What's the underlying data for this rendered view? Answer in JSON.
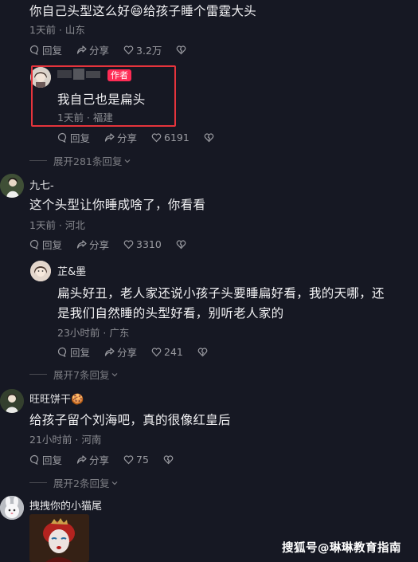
{
  "comments": [
    {
      "text": "你自己头型这么好😄给孩子睡个雷霆大头",
      "meta": "1天前 · 山东",
      "reply": "回复",
      "share": "分享",
      "likes": "3.2万"
    },
    {
      "badge": "作者",
      "text": "我自己也是扁头",
      "meta": "1天前 · 福建",
      "reply": "回复",
      "share": "分享",
      "likes": "6191"
    },
    {
      "expand": "展开281条回复"
    },
    {
      "name": "九七-",
      "text": "这个头型让你睡成啥了，你看看",
      "meta": "1天前 · 河北",
      "reply": "回复",
      "share": "分享",
      "likes": "3310"
    },
    {
      "name": "芷&墨",
      "text_line1": "扁头好丑，老人家还说小孩子头要睡扁好看，我的天哪，还",
      "text_line2": "是我们自然睡的头型好看，别听老人家的",
      "meta": "23小时前 · 广东",
      "reply": "回复",
      "share": "分享",
      "likes": "241"
    },
    {
      "expand": "展开7条回复"
    },
    {
      "name": "旺旺饼干🍪",
      "text": "给孩子留个刘海吧，真的很像红皇后",
      "meta": "21小时前 · 河南",
      "reply": "回复",
      "share": "分享",
      "likes": "75"
    },
    {
      "expand": "展开2条回复"
    },
    {
      "name": "拽拽你的小猫尾"
    }
  ],
  "watermark": "搜狐号@琳琳教育指南",
  "colors": {
    "background": "#161823",
    "accent": "#fe2c55",
    "highlight_box": "#e5343c"
  }
}
